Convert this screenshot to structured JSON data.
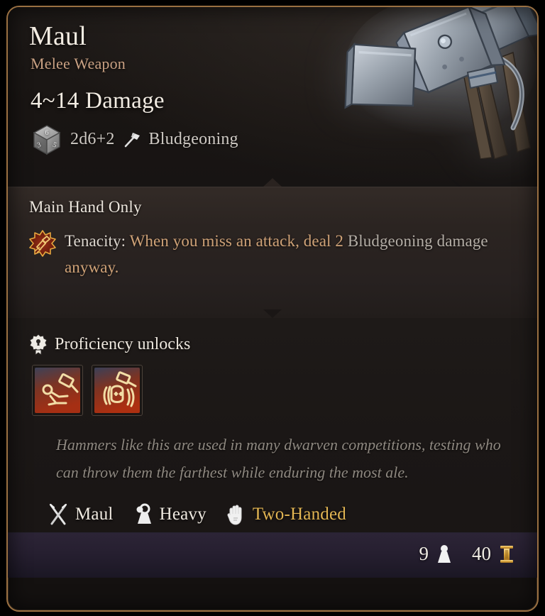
{
  "item": {
    "name": "Maul",
    "category": "Melee Weapon",
    "damage_range": "4~14 Damage",
    "damage_dice": "2d6+2",
    "damage_type": "Bludgeoning",
    "artwork_icon": "maul-weapon-art",
    "dice_icon": "d6-die-icon",
    "damage_type_icon": "bludgeoning-hammer-icon"
  },
  "properties": {
    "slot_restriction": "Main Hand Only",
    "passive": {
      "icon": "tenacity-starburst-icon",
      "name": "Tenacity:",
      "desc_part1": "When you miss an attack, deal 2",
      "desc_part2": "Bludgeoning",
      "desc_part3": "damage",
      "desc_part4": "anyway."
    }
  },
  "proficiency": {
    "header": "Proficiency unlocks",
    "header_icon": "proficiency-seal-icon",
    "unlocks": [
      {
        "name": "topple-ability-icon"
      },
      {
        "name": "concussive-smash-ability-icon"
      }
    ]
  },
  "flavor_text": "Hammers like this are used in many dwarven competitions, testing who can throw them the farthest while enduring the most ale.",
  "tags": [
    {
      "label": "Maul",
      "icon": "crossed-swords-icon",
      "highlight": false
    },
    {
      "label": "Heavy",
      "icon": "weight-icon",
      "highlight": false
    },
    {
      "label": "Two-Handed",
      "icon": "open-hand-icon",
      "highlight": true
    }
  ],
  "footer": {
    "weight_value": "9",
    "weight_icon": "weight-drop-icon",
    "price_value": "40",
    "price_icon": "gold-coin-icon"
  },
  "colors": {
    "frame_border": "#9a7042",
    "title": "#f3ece2",
    "subtitle": "#c9a183",
    "gold_highlight": "#e2b553",
    "passive_gold": "#cfa277",
    "flavor": "#8e8880"
  }
}
